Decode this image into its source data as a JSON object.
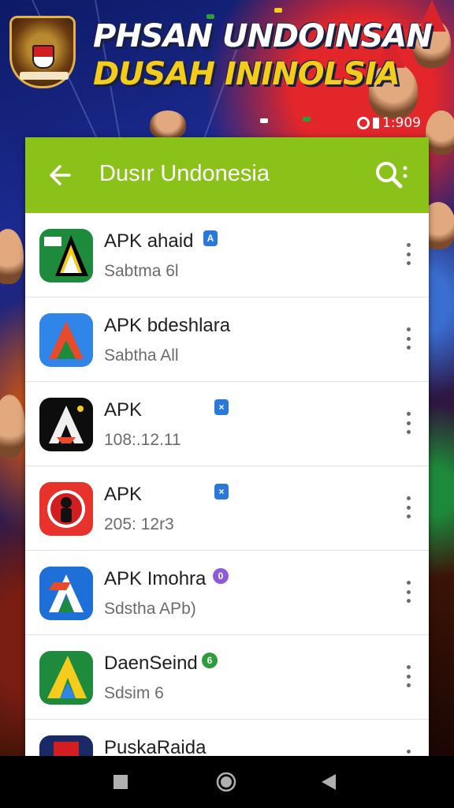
{
  "background": {
    "headline_line1": "PHSAN UNDOINSAN",
    "headline_line2": "DUSAH ININOLSIA",
    "status_text": "1:909"
  },
  "appbar": {
    "title": "Dusır Undonesia",
    "color": "#8bc21a"
  },
  "apps": [
    {
      "title": "APK ahaid",
      "subtitle": "Sabtma 6l",
      "badge": "A",
      "badge_color": "#2a78d8",
      "icon": "app-icon-green-a"
    },
    {
      "title": "APK bdeshlara",
      "subtitle": "Sabtha All",
      "badge": "",
      "badge_color": "",
      "icon": "app-icon-blue-a"
    },
    {
      "title": "APK",
      "subtitle": "108:.12.11",
      "badge": "×",
      "badge_color": "#2a78d8",
      "icon": "app-icon-black-a"
    },
    {
      "title": "APK",
      "subtitle": "205: 12r3",
      "badge": "×",
      "badge_color": "#2a78d8",
      "icon": "app-icon-red-figure"
    },
    {
      "title": "APK Imohra",
      "subtitle": "Sdstha APb)",
      "badge": "0",
      "badge_color": "#8e5bd8",
      "icon": "app-icon-blue-a2"
    },
    {
      "title": "DaenSeind",
      "subtitle": "Sdsim 6",
      "badge": "6",
      "badge_color": "#2e9c3c",
      "icon": "app-icon-green-yellow-a"
    },
    {
      "title": "PuskaRaida",
      "subtitle": "",
      "badge": "",
      "badge_color": "",
      "icon": "app-icon-dark-blue"
    }
  ],
  "navigation": {
    "recent": "recent-apps-icon",
    "home": "home-icon",
    "back": "back-triangle-icon"
  }
}
